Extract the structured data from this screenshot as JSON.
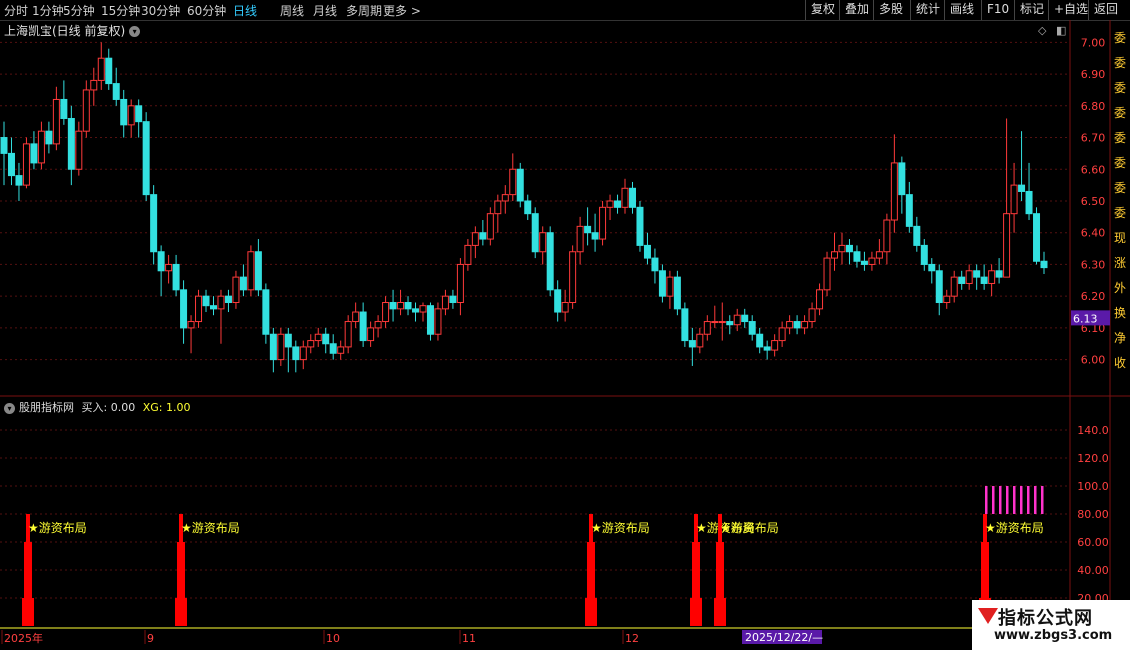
{
  "toolbar": {
    "periods": [
      "分时",
      "1分钟",
      "5分钟",
      "15分钟",
      "30分钟",
      "60分钟",
      "日线",
      "周线",
      "月线",
      "多周期",
      "更多 >"
    ],
    "active_index": 6,
    "right_buttons": [
      "复权",
      "叠加",
      "多股",
      "统计",
      "画线",
      "F10",
      "标记",
      "+自选",
      "返回"
    ]
  },
  "stock": {
    "title": "上海凯宝(日线 前复权)"
  },
  "price_axis": {
    "labels": [
      "7.00",
      "6.90",
      "6.80",
      "6.70",
      "6.60",
      "6.50",
      "6.40",
      "6.30",
      "6.20",
      "6.10",
      "6.00"
    ],
    "current": "6.13"
  },
  "indicator": {
    "name": "股朋指标网",
    "buy": "买入: 0.00",
    "xg": "XG: 1.00",
    "axis_labels": [
      "140.0",
      "120.0",
      "100.0",
      "80.00",
      "60.00",
      "40.00",
      "20.00"
    ],
    "signal_text": "★游资布局",
    "signal_overlap_text": "★游资布局"
  },
  "date_axis": {
    "labels": [
      "2025年",
      "9",
      "10",
      "11",
      "12"
    ],
    "cursor_date": "2025/12/22/—"
  },
  "right_strip_chars": [
    "委",
    "委",
    "委",
    "委",
    "委",
    "委",
    "委",
    "委",
    "现",
    "涨",
    "外",
    "换",
    "净",
    "收"
  ],
  "watermark": {
    "logo": "指标公式网",
    "url": "www.zbgs3.com"
  },
  "colors": {
    "up": "#ff3a3a",
    "down": "#33e0e0",
    "signal": "#ff0000",
    "magenta": "#ff33cc",
    "yellow": "#ffff33",
    "grid": "#551111"
  },
  "chart_data": {
    "type": "candlestick",
    "ylim": [
      5.92,
      7.02
    ],
    "candles": [
      [
        6.7,
        6.75,
        6.55,
        6.65
      ],
      [
        6.65,
        6.7,
        6.55,
        6.58
      ],
      [
        6.58,
        6.62,
        6.5,
        6.55
      ],
      [
        6.55,
        6.7,
        6.54,
        6.68
      ],
      [
        6.68,
        6.72,
        6.6,
        6.62
      ],
      [
        6.62,
        6.75,
        6.6,
        6.72
      ],
      [
        6.72,
        6.75,
        6.65,
        6.68
      ],
      [
        6.68,
        6.86,
        6.66,
        6.82
      ],
      [
        6.82,
        6.88,
        6.74,
        6.76
      ],
      [
        6.76,
        6.8,
        6.55,
        6.6
      ],
      [
        6.6,
        6.75,
        6.58,
        6.72
      ],
      [
        6.72,
        6.88,
        6.7,
        6.85
      ],
      [
        6.85,
        6.92,
        6.8,
        6.88
      ],
      [
        6.88,
        7.0,
        6.85,
        6.95
      ],
      [
        6.95,
        6.98,
        6.85,
        6.87
      ],
      [
        6.87,
        6.92,
        6.8,
        6.82
      ],
      [
        6.82,
        6.85,
        6.7,
        6.74
      ],
      [
        6.74,
        6.82,
        6.7,
        6.8
      ],
      [
        6.8,
        6.82,
        6.7,
        6.75
      ],
      [
        6.75,
        6.78,
        6.5,
        6.52
      ],
      [
        6.52,
        6.55,
        6.3,
        6.34
      ],
      [
        6.34,
        6.36,
        6.2,
        6.28
      ],
      [
        6.28,
        6.33,
        6.24,
        6.3
      ],
      [
        6.3,
        6.33,
        6.2,
        6.22
      ],
      [
        6.22,
        6.25,
        6.05,
        6.1
      ],
      [
        6.1,
        6.14,
        6.02,
        6.12
      ],
      [
        6.12,
        6.22,
        6.1,
        6.2
      ],
      [
        6.2,
        6.22,
        6.15,
        6.17
      ],
      [
        6.17,
        6.2,
        6.14,
        6.16
      ],
      [
        6.16,
        6.22,
        6.05,
        6.2
      ],
      [
        6.2,
        6.22,
        6.15,
        6.18
      ],
      [
        6.18,
        6.28,
        6.16,
        6.26
      ],
      [
        6.26,
        6.3,
        6.2,
        6.22
      ],
      [
        6.22,
        6.36,
        6.2,
        6.34
      ],
      [
        6.34,
        6.38,
        6.2,
        6.22
      ],
      [
        6.22,
        6.24,
        6.05,
        6.08
      ],
      [
        6.08,
        6.1,
        5.96,
        6.0
      ],
      [
        6.0,
        6.1,
        5.98,
        6.08
      ],
      [
        6.08,
        6.1,
        5.96,
        6.04
      ],
      [
        6.04,
        6.06,
        5.96,
        6.0
      ],
      [
        6.0,
        6.06,
        5.97,
        6.04
      ],
      [
        6.04,
        6.08,
        6.02,
        6.06
      ],
      [
        6.06,
        6.1,
        6.04,
        6.08
      ],
      [
        6.08,
        6.1,
        6.02,
        6.05
      ],
      [
        6.05,
        6.08,
        6.0,
        6.02
      ],
      [
        6.02,
        6.06,
        6.0,
        6.04
      ],
      [
        6.04,
        6.14,
        6.02,
        6.12
      ],
      [
        6.12,
        6.18,
        6.1,
        6.15
      ],
      [
        6.15,
        6.18,
        6.04,
        6.06
      ],
      [
        6.06,
        6.12,
        6.04,
        6.1
      ],
      [
        6.1,
        6.14,
        6.07,
        6.12
      ],
      [
        6.12,
        6.2,
        6.1,
        6.18
      ],
      [
        6.18,
        6.22,
        6.12,
        6.16
      ],
      [
        6.16,
        6.22,
        6.14,
        6.18
      ],
      [
        6.18,
        6.2,
        6.14,
        6.16
      ],
      [
        6.16,
        6.18,
        6.12,
        6.15
      ],
      [
        6.15,
        6.18,
        6.12,
        6.17
      ],
      [
        6.17,
        6.18,
        6.06,
        6.08
      ],
      [
        6.08,
        6.18,
        6.06,
        6.16
      ],
      [
        6.16,
        6.22,
        6.14,
        6.2
      ],
      [
        6.2,
        6.22,
        6.16,
        6.18
      ],
      [
        6.18,
        6.32,
        6.14,
        6.3
      ],
      [
        6.3,
        6.38,
        6.28,
        6.36
      ],
      [
        6.36,
        6.42,
        6.32,
        6.4
      ],
      [
        6.4,
        6.44,
        6.36,
        6.38
      ],
      [
        6.38,
        6.48,
        6.36,
        6.46
      ],
      [
        6.46,
        6.52,
        6.4,
        6.5
      ],
      [
        6.5,
        6.55,
        6.46,
        6.52
      ],
      [
        6.52,
        6.65,
        6.5,
        6.6
      ],
      [
        6.6,
        6.62,
        6.48,
        6.5
      ],
      [
        6.5,
        6.52,
        6.44,
        6.46
      ],
      [
        6.46,
        6.48,
        6.32,
        6.34
      ],
      [
        6.34,
        6.42,
        6.3,
        6.4
      ],
      [
        6.4,
        6.42,
        6.2,
        6.22
      ],
      [
        6.22,
        6.25,
        6.12,
        6.15
      ],
      [
        6.15,
        6.22,
        6.12,
        6.18
      ],
      [
        6.18,
        6.36,
        6.16,
        6.34
      ],
      [
        6.34,
        6.45,
        6.3,
        6.42
      ],
      [
        6.42,
        6.48,
        6.36,
        6.4
      ],
      [
        6.4,
        6.46,
        6.34,
        6.38
      ],
      [
        6.38,
        6.5,
        6.36,
        6.48
      ],
      [
        6.48,
        6.52,
        6.44,
        6.5
      ],
      [
        6.5,
        6.52,
        6.46,
        6.48
      ],
      [
        6.48,
        6.57,
        6.46,
        6.54
      ],
      [
        6.54,
        6.56,
        6.46,
        6.48
      ],
      [
        6.48,
        6.5,
        6.34,
        6.36
      ],
      [
        6.36,
        6.4,
        6.3,
        6.32
      ],
      [
        6.32,
        6.35,
        6.24,
        6.28
      ],
      [
        6.28,
        6.3,
        6.18,
        6.2
      ],
      [
        6.2,
        6.28,
        6.16,
        6.26
      ],
      [
        6.26,
        6.28,
        6.14,
        6.16
      ],
      [
        6.16,
        6.18,
        6.04,
        6.06
      ],
      [
        6.06,
        6.1,
        5.98,
        6.04
      ],
      [
        6.04,
        6.1,
        6.02,
        6.08
      ],
      [
        6.08,
        6.14,
        6.06,
        6.12
      ],
      [
        6.12,
        6.17,
        6.1,
        6.12
      ],
      [
        6.12,
        6.18,
        6.06,
        6.12
      ],
      [
        6.12,
        6.14,
        6.08,
        6.11
      ],
      [
        6.11,
        6.16,
        6.09,
        6.14
      ],
      [
        6.14,
        6.16,
        6.1,
        6.12
      ],
      [
        6.12,
        6.14,
        6.06,
        6.08
      ],
      [
        6.08,
        6.1,
        6.02,
        6.04
      ],
      [
        6.04,
        6.06,
        6.0,
        6.03
      ],
      [
        6.03,
        6.08,
        6.01,
        6.06
      ],
      [
        6.06,
        6.12,
        6.04,
        6.1
      ],
      [
        6.1,
        6.14,
        6.08,
        6.12
      ],
      [
        6.12,
        6.14,
        6.08,
        6.1
      ],
      [
        6.1,
        6.14,
        6.08,
        6.12
      ],
      [
        6.12,
        6.18,
        6.1,
        6.16
      ],
      [
        6.16,
        6.24,
        6.14,
        6.22
      ],
      [
        6.22,
        6.34,
        6.2,
        6.32
      ],
      [
        6.32,
        6.4,
        6.28,
        6.34
      ],
      [
        6.34,
        6.4,
        6.3,
        6.36
      ],
      [
        6.36,
        6.38,
        6.3,
        6.34
      ],
      [
        6.34,
        6.36,
        6.29,
        6.31
      ],
      [
        6.31,
        6.34,
        6.28,
        6.3
      ],
      [
        6.3,
        6.34,
        6.28,
        6.32
      ],
      [
        6.32,
        6.38,
        6.3,
        6.34
      ],
      [
        6.34,
        6.46,
        6.3,
        6.44
      ],
      [
        6.44,
        6.71,
        6.4,
        6.62
      ],
      [
        6.62,
        6.64,
        6.46,
        6.52
      ],
      [
        6.52,
        6.56,
        6.4,
        6.42
      ],
      [
        6.42,
        6.45,
        6.34,
        6.36
      ],
      [
        6.36,
        6.38,
        6.28,
        6.3
      ],
      [
        6.3,
        6.32,
        6.24,
        6.28
      ],
      [
        6.28,
        6.3,
        6.14,
        6.18
      ],
      [
        6.18,
        6.22,
        6.16,
        6.2
      ],
      [
        6.2,
        6.28,
        6.18,
        6.26
      ],
      [
        6.26,
        6.28,
        6.22,
        6.24
      ],
      [
        6.24,
        6.3,
        6.22,
        6.28
      ],
      [
        6.28,
        6.3,
        6.22,
        6.26
      ],
      [
        6.26,
        6.3,
        6.22,
        6.24
      ],
      [
        6.24,
        6.3,
        6.2,
        6.28
      ],
      [
        6.28,
        6.32,
        6.24,
        6.26
      ],
      [
        6.26,
        6.76,
        6.4,
        6.46
      ],
      [
        6.46,
        6.62,
        6.4,
        6.55
      ],
      [
        6.55,
        6.72,
        6.5,
        6.53
      ],
      [
        6.53,
        6.62,
        6.44,
        6.46
      ],
      [
        6.46,
        6.48,
        6.3,
        6.31
      ],
      [
        6.31,
        6.34,
        6.27,
        6.29
      ]
    ]
  }
}
